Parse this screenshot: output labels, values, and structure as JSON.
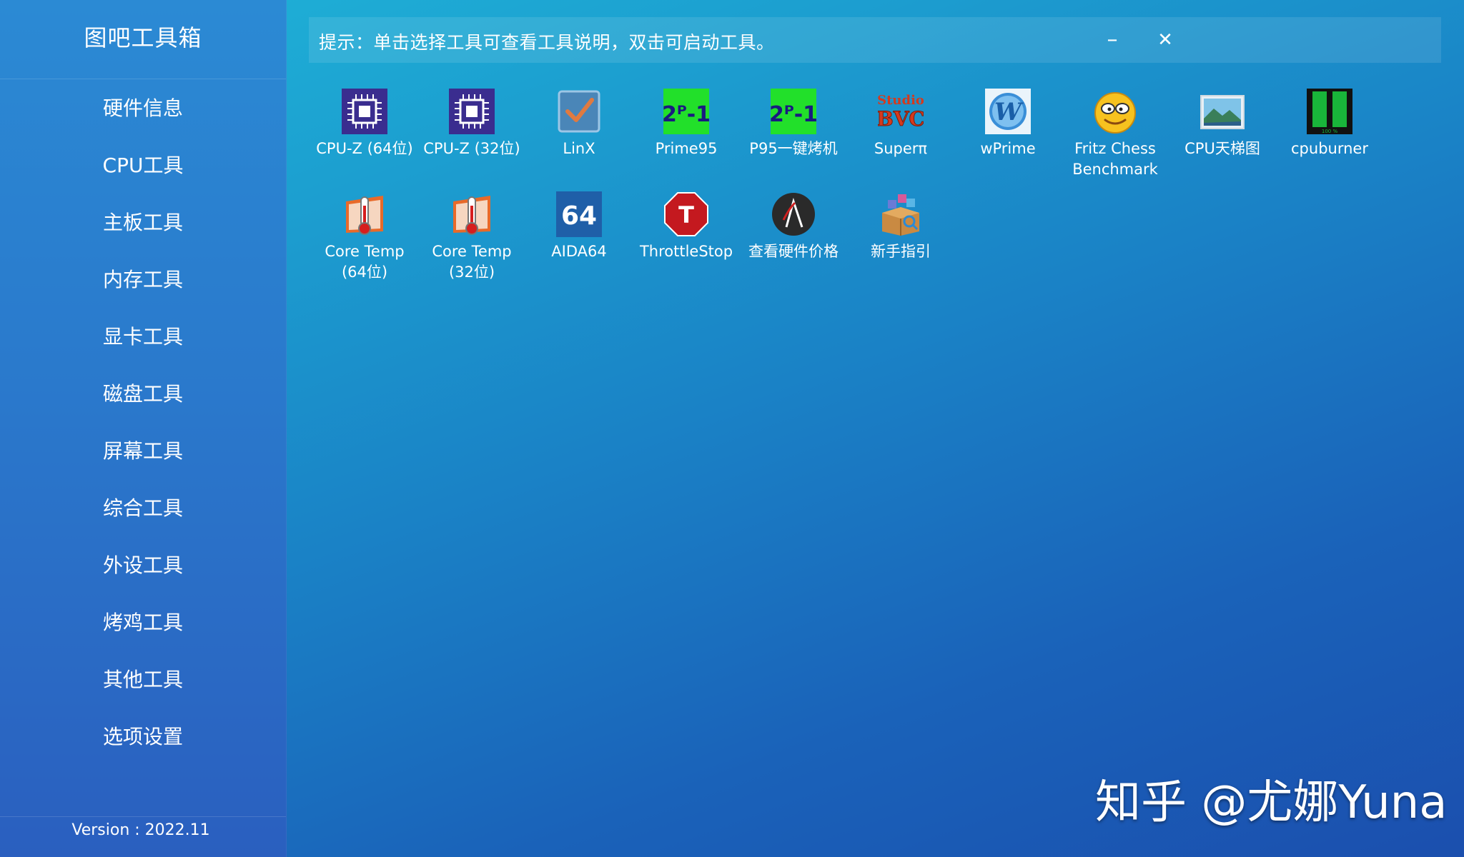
{
  "app": {
    "title": "图吧工具箱",
    "version": "Version : 2022.11"
  },
  "sidebar": {
    "items": [
      {
        "label": "硬件信息"
      },
      {
        "label": "CPU工具"
      },
      {
        "label": "主板工具"
      },
      {
        "label": "内存工具"
      },
      {
        "label": "显卡工具"
      },
      {
        "label": "磁盘工具"
      },
      {
        "label": "屏幕工具"
      },
      {
        "label": "综合工具"
      },
      {
        "label": "外设工具"
      },
      {
        "label": "烤鸡工具"
      },
      {
        "label": "其他工具"
      },
      {
        "label": "选项设置"
      }
    ]
  },
  "hint": {
    "text": "提示：单击选择工具可查看工具说明，双击可启动工具。",
    "minimize": "–",
    "close": "✕"
  },
  "tools": [
    {
      "label": "CPU-Z (64位)",
      "icon": "cpu-z-icon"
    },
    {
      "label": "CPU-Z (32位)",
      "icon": "cpu-z-icon"
    },
    {
      "label": "LinX",
      "icon": "linx-check-icon"
    },
    {
      "label": "Prime95",
      "icon": "prime95-icon",
      "icon_text": "2ᴾ-1"
    },
    {
      "label": "P95一键烤机",
      "icon": "prime95-icon",
      "icon_text": "2ᴾ-1"
    },
    {
      "label": "Superπ",
      "icon": "superpi-icon",
      "icon_text": "BVC"
    },
    {
      "label": "wPrime",
      "icon": "wprime-icon",
      "icon_text": "W"
    },
    {
      "label": "Fritz Chess\nBenchmark",
      "icon": "fritz-face-icon"
    },
    {
      "label": "CPU天梯图",
      "icon": "landscape-image-icon"
    },
    {
      "label": "cpuburner",
      "icon": "cpuburner-icon"
    },
    {
      "label": "Core Temp\n(64位)",
      "icon": "thermometer-icon"
    },
    {
      "label": "Core Temp\n(32位)",
      "icon": "thermometer-icon"
    },
    {
      "label": "AIDA64",
      "icon": "aida64-icon",
      "icon_text": "64"
    },
    {
      "label": "ThrottleStop",
      "icon": "throttlestop-icon",
      "icon_text": "T"
    },
    {
      "label": "查看硬件价格",
      "icon": "price-check-icon"
    },
    {
      "label": "新手指引",
      "icon": "guide-box-icon"
    }
  ],
  "watermark": "知乎 @尤娜Yuna",
  "colors": {
    "accent": "#1a82c6",
    "sidebar": "#2a79cc",
    "text": "#ffffff"
  }
}
